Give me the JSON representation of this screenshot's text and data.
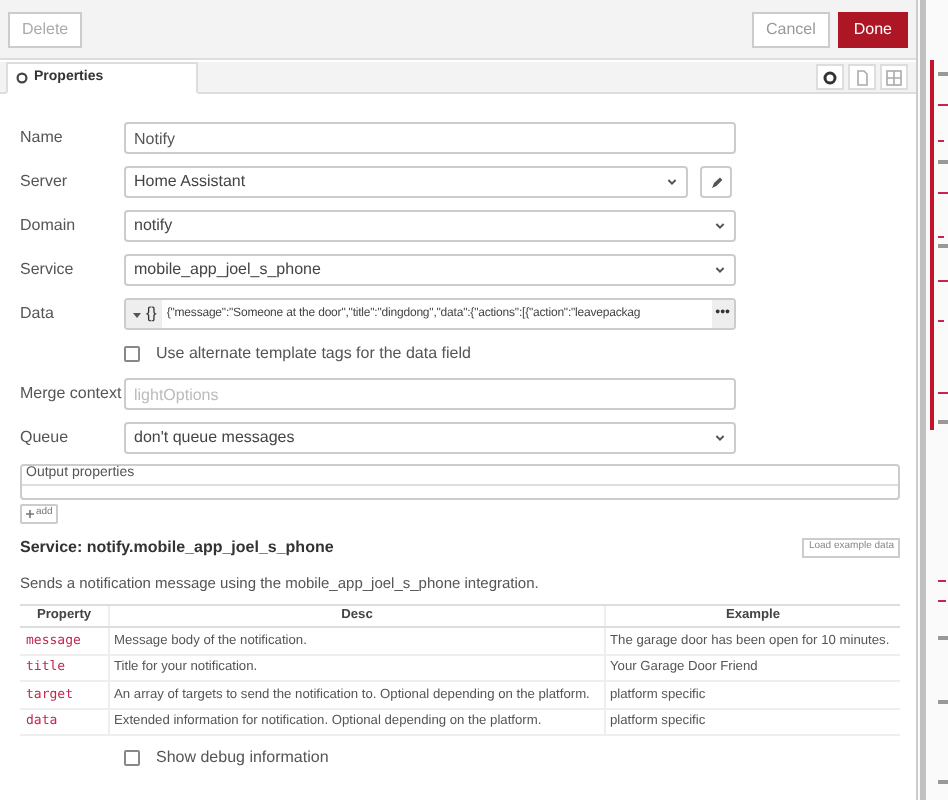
{
  "toolbar": {
    "delete": "Delete",
    "cancel": "Cancel",
    "done": "Done"
  },
  "tabs": [
    {
      "label": "Properties",
      "selected": true
    }
  ],
  "fields": [
    {
      "kind": "text",
      "label": "Name",
      "value": "Notify"
    },
    {
      "kind": "select",
      "label": "Server",
      "value": "Home Assistant",
      "edit_button": true
    },
    {
      "kind": "select",
      "label": "Domain",
      "value": "notify"
    },
    {
      "kind": "select",
      "label": "Service",
      "value": "mobile_app_joel_s_phone"
    },
    {
      "kind": "typed",
      "label": "Data",
      "type_marker": "{}",
      "value": "{\"message\":\"Someone at the door\",\"title\":\"dingdong\",\"data\":{\"actions\":[{\"action\":\"leavepackag",
      "more": "•••"
    },
    {
      "kind": "checkbox",
      "label": "Use alternate template tags for the data field",
      "checked": false
    },
    {
      "kind": "text",
      "label": "Merge context",
      "placeholder": "lightOptions"
    },
    {
      "kind": "select",
      "label": "Queue",
      "value": "don't queue messages"
    }
  ],
  "output_properties": {
    "title": "Output properties",
    "add": "add"
  },
  "service": {
    "heading": "Service: notify.mobile_app_joel_s_phone",
    "load_button": "Load example data",
    "description": "Sends a notification message using the mobile_app_joel_s_phone integration.",
    "columns": [
      "Property",
      "Desc",
      "Example"
    ],
    "rows": [
      [
        "message",
        "Message body of the notification.",
        "The garage door has been open for 10 minutes."
      ],
      [
        "title",
        "Title for your notification.",
        "Your Garage Door Friend"
      ],
      [
        "target",
        "An array of targets to send the notification to. Optional depending on the platform.",
        "platform specific"
      ],
      [
        "data",
        "Extended information for notification. Optional depending on the platform.",
        "platform specific"
      ]
    ]
  },
  "debug": {
    "label": "Show debug information",
    "checked": false
  }
}
